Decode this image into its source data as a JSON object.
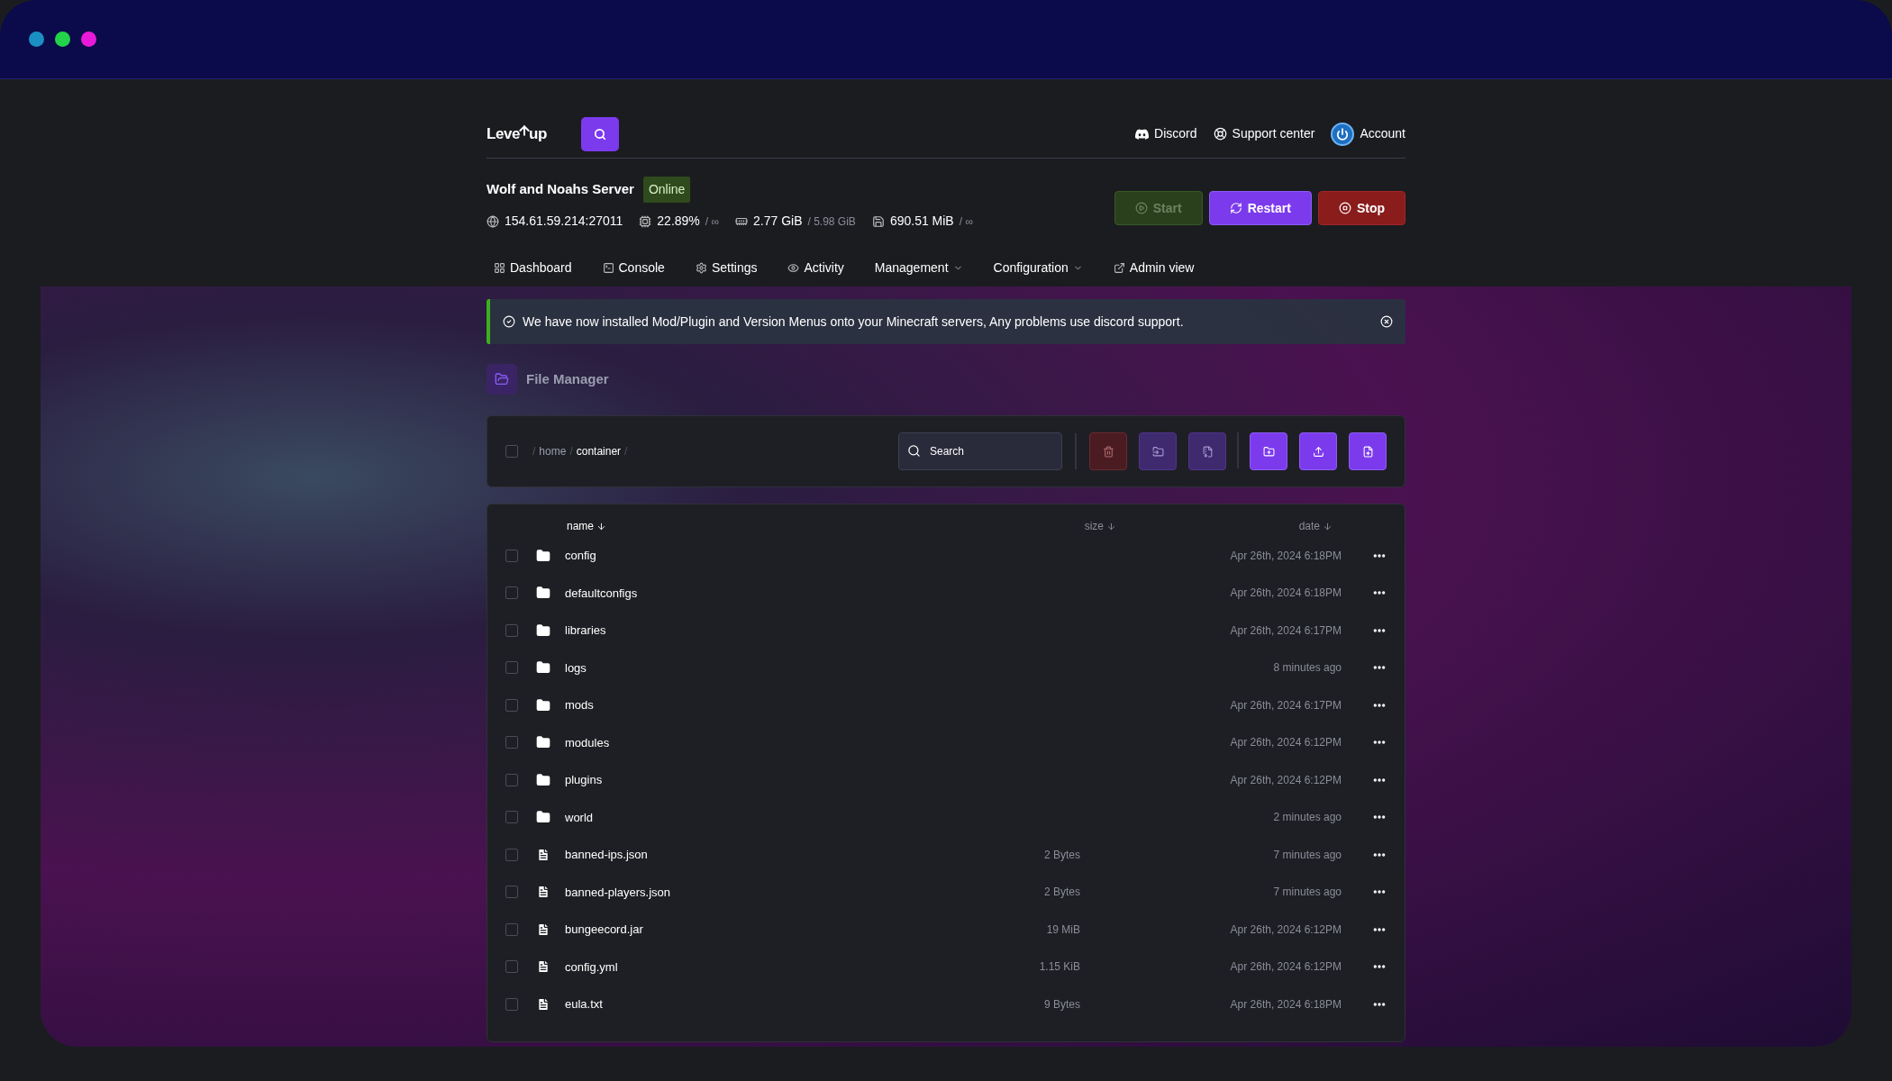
{
  "window_dots": [
    {
      "color": "#1a8fc4"
    },
    {
      "color": "#22d34a"
    },
    {
      "color": "#e81ad8"
    }
  ],
  "brand": {
    "left": "Leve",
    "right": "up"
  },
  "nav_links": [
    {
      "kind": "discord",
      "label": "Discord"
    },
    {
      "kind": "support",
      "label": "Support center"
    },
    {
      "kind": "account",
      "label": "Account"
    }
  ],
  "server": {
    "name": "Wolf and Noahs Server",
    "status": "Online",
    "stats": [
      {
        "kind": "address",
        "value": "154.61.59.214:27011"
      },
      {
        "kind": "cpu",
        "value": "22.89%",
        "limit": "/ ∞"
      },
      {
        "kind": "memory",
        "value": "2.77 GiB",
        "limit": "/ 5.98 GiB"
      },
      {
        "kind": "disk",
        "value": "690.51 MiB",
        "limit": "/ ∞"
      }
    ]
  },
  "power_buttons": [
    {
      "kind": "start",
      "label": "Start",
      "disabled": true
    },
    {
      "kind": "restart",
      "label": "Restart",
      "disabled": false
    },
    {
      "kind": "stop",
      "label": "Stop",
      "disabled": false
    }
  ],
  "tabs": [
    {
      "kind": "dashboard",
      "label": "Dashboard",
      "dropdown": false
    },
    {
      "kind": "console",
      "label": "Console",
      "dropdown": false
    },
    {
      "kind": "settings",
      "label": "Settings",
      "dropdown": false
    },
    {
      "kind": "activity",
      "label": "Activity",
      "dropdown": false
    },
    {
      "kind": "none",
      "label": "Management",
      "dropdown": true
    },
    {
      "kind": "none",
      "label": "Configuration",
      "dropdown": true
    },
    {
      "kind": "external",
      "label": "Admin view",
      "dropdown": false
    }
  ],
  "notice": {
    "text": "We have now installed Mod/Plugin and Version Menus onto your Minecraft servers, Any problems use discord support."
  },
  "file_manager": {
    "title": "File Manager",
    "select_all_checked": false,
    "breadcrumb": [
      {
        "kind": "sep",
        "text": "/"
      },
      {
        "kind": "link",
        "text": "home"
      },
      {
        "kind": "sep",
        "text": "/"
      },
      {
        "kind": "current",
        "text": "container"
      },
      {
        "kind": "sep",
        "text": "/"
      }
    ],
    "search": {
      "placeholder": "Search"
    },
    "actions": [
      {
        "kind": "delete",
        "disabled": true
      },
      {
        "kind": "move",
        "disabled": true
      },
      {
        "kind": "archive",
        "disabled": true
      },
      {
        "kind": "new-folder",
        "disabled": false
      },
      {
        "kind": "upload",
        "disabled": false
      },
      {
        "kind": "new-file",
        "disabled": false
      }
    ]
  },
  "table": {
    "columns": [
      {
        "label": "name",
        "sorted": true
      },
      {
        "label": "size",
        "sorted": false
      },
      {
        "label": "date",
        "sorted": false
      }
    ],
    "rows": [
      {
        "kind": "folder",
        "name": "config",
        "date": "Apr 26th, 2024 6:18PM",
        "checked": false
      },
      {
        "kind": "folder",
        "name": "defaultconfigs",
        "date": "Apr 26th, 2024 6:18PM",
        "checked": false
      },
      {
        "kind": "folder",
        "name": "libraries",
        "date": "Apr 26th, 2024 6:17PM",
        "checked": false
      },
      {
        "kind": "folder",
        "name": "logs",
        "date": "8 minutes ago",
        "checked": false
      },
      {
        "kind": "folder",
        "name": "mods",
        "date": "Apr 26th, 2024 6:17PM",
        "checked": false
      },
      {
        "kind": "folder",
        "name": "modules",
        "date": "Apr 26th, 2024 6:12PM",
        "checked": false
      },
      {
        "kind": "folder",
        "name": "plugins",
        "date": "Apr 26th, 2024 6:12PM",
        "checked": false
      },
      {
        "kind": "folder",
        "name": "world",
        "date": "2 minutes ago",
        "checked": false
      },
      {
        "kind": "file",
        "name": "banned-ips.json",
        "size": "2 Bytes",
        "date": "7 minutes ago",
        "checked": false
      },
      {
        "kind": "file",
        "name": "banned-players.json",
        "size": "2 Bytes",
        "date": "7 minutes ago",
        "checked": false
      },
      {
        "kind": "file",
        "name": "bungeecord.jar",
        "size": "19 MiB",
        "date": "Apr 26th, 2024 6:12PM",
        "checked": false
      },
      {
        "kind": "file",
        "name": "config.yml",
        "size": "1.15 KiB",
        "date": "Apr 26th, 2024 6:12PM",
        "checked": false
      },
      {
        "kind": "file",
        "name": "eula.txt",
        "size": "9 Bytes",
        "date": "Apr 26th, 2024 6:18PM",
        "checked": false
      }
    ]
  }
}
